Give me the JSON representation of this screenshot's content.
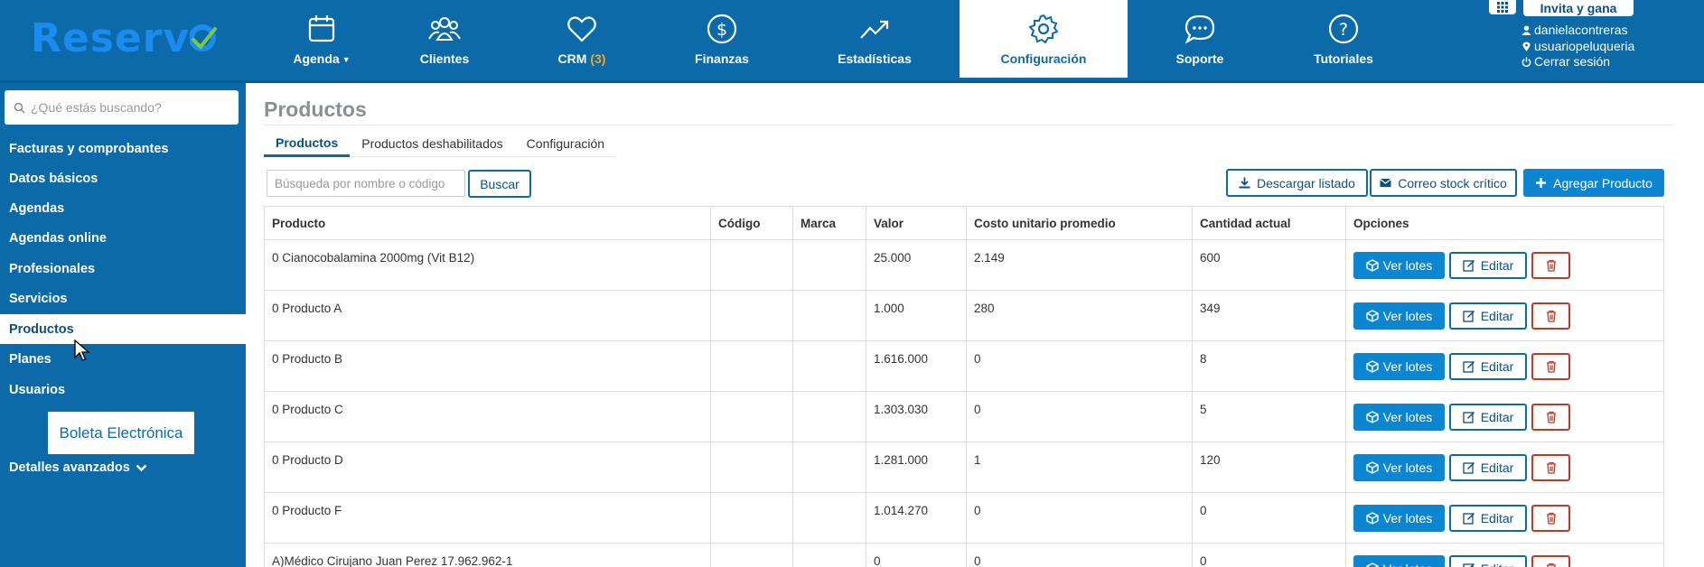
{
  "brand": {
    "logo_text": "Reserv",
    "brand_color": "#1a8cf0",
    "check_color": "#7ac943"
  },
  "colors": {
    "primary": "#0d6aa8",
    "accent_button": "#0d86d1",
    "danger": "#c0392b",
    "crm_badge": "#f5a623"
  },
  "topnav": {
    "items": [
      {
        "label": "Agenda",
        "icon": "calendar-icon"
      },
      {
        "label": "Clientes",
        "icon": "users-icon"
      },
      {
        "label": "CRM",
        "count": "(3)",
        "icon": "heart-icon"
      },
      {
        "label": "Finanzas",
        "icon": "dollar-icon"
      },
      {
        "label": "Estadísticas",
        "icon": "trend-icon"
      },
      {
        "label": "Configuración",
        "icon": "gear-icon"
      },
      {
        "label": "Soporte",
        "icon": "chat-icon"
      },
      {
        "label": "Tutoriales",
        "icon": "help-icon"
      }
    ],
    "active": "Configuración"
  },
  "header_right": {
    "invite_label": "Invita y gana",
    "username": "danielacontreras",
    "location": "usuariopeluqueria",
    "logout": "Cerrar sesión"
  },
  "sidebar": {
    "search_placeholder": "¿Qué estás buscando?",
    "items": [
      {
        "label": "Facturas y comprobantes"
      },
      {
        "label": "Datos básicos"
      },
      {
        "label": "Agendas"
      },
      {
        "label": "Agendas online"
      },
      {
        "label": "Profesionales"
      },
      {
        "label": "Servicios"
      },
      {
        "label": "Productos"
      },
      {
        "label": "Planes"
      },
      {
        "label": "Usuarios"
      }
    ],
    "active": "Productos",
    "boleta_label": "Boleta Electrónica",
    "advanced_label": "Detalles avanzados"
  },
  "main": {
    "title": "Productos",
    "tabs": [
      {
        "label": "Productos"
      },
      {
        "label": "Productos deshabilitados"
      },
      {
        "label": "Configuración"
      }
    ],
    "active_tab": "Productos",
    "filter_placeholder": "Búsqueda por nombre o código",
    "search_button": "Buscar",
    "actions": {
      "download": "Descargar listado",
      "email": "Correo stock crítico",
      "add": "Agregar Producto"
    },
    "table": {
      "headers": [
        "Producto",
        "Código",
        "Marca",
        "Valor",
        "Costo unitario promedio",
        "Cantidad actual",
        "Opciones"
      ],
      "row_buttons": {
        "lots": "Ver lotes",
        "edit": "Editar"
      },
      "rows": [
        [
          "0 Cianocobalamina 2000mg (Vit B12)",
          "",
          "",
          "25.000",
          "2.149",
          "600"
        ],
        [
          "0 Producto A",
          "",
          "",
          "1.000",
          "280",
          "349"
        ],
        [
          "0 Producto B",
          "",
          "",
          "1.616.000",
          "0",
          "8"
        ],
        [
          "0 Producto C",
          "",
          "",
          "1.303.030",
          "0",
          "5"
        ],
        [
          "0 Producto D",
          "",
          "",
          "1.281.000",
          "1",
          "120"
        ],
        [
          "0 Producto F",
          "",
          "",
          "1.014.270",
          "0",
          "0"
        ],
        [
          "A)Médico Cirujano Juan Perez 17.962.962-1",
          "",
          "",
          "0",
          "0",
          "0"
        ]
      ]
    }
  }
}
